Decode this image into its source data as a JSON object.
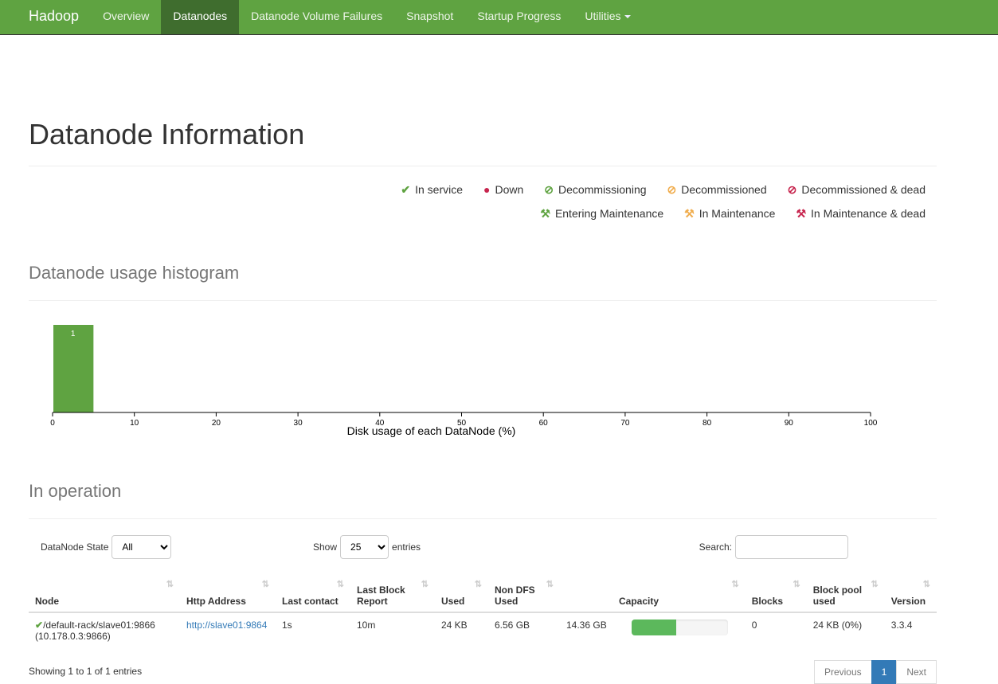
{
  "navbar": {
    "brand": "Hadoop",
    "items": [
      "Overview",
      "Datanodes",
      "Datanode Volume Failures",
      "Snapshot",
      "Startup Progress",
      "Utilities"
    ],
    "active": "Datanodes"
  },
  "page_title": "Datanode Information",
  "legend": [
    {
      "icon": "check-icon",
      "label": "In service",
      "color": "#5fa341"
    },
    {
      "icon": "exclamation-circle-icon",
      "label": "Down",
      "color": "#c7254e"
    },
    {
      "icon": "ban-icon",
      "label": "Decommissioning",
      "color": "#5fa341"
    },
    {
      "icon": "ban-icon",
      "label": "Decommissioned",
      "color": "#f0ad4e"
    },
    {
      "icon": "ban-icon",
      "label": "Decommissioned & dead",
      "color": "#c7254e"
    },
    {
      "icon": "wrench-icon",
      "label": "Entering Maintenance",
      "color": "#5fa341"
    },
    {
      "icon": "wrench-icon",
      "label": "In Maintenance",
      "color": "#f0ad4e"
    },
    {
      "icon": "wrench-icon",
      "label": "In Maintenance & dead",
      "color": "#c7254e"
    }
  ],
  "histogram": {
    "heading": "Datanode usage histogram",
    "chart_data": {
      "type": "bar",
      "xlabel": "Disk usage of each DataNode (%)",
      "xlim": [
        0,
        100
      ],
      "xticks": [
        "0",
        "10",
        "20",
        "30",
        "40",
        "50",
        "60",
        "70",
        "80",
        "90",
        "100"
      ],
      "bins": [
        {
          "x0": 0,
          "x1": 5,
          "count": 1
        }
      ],
      "bar_color": "#5fa341"
    }
  },
  "operation": {
    "heading": "In operation",
    "state_label": "DataNode State",
    "state_value": "All",
    "show_label": "Show",
    "show_value": "25",
    "entries_label": "entries",
    "search_label": "Search:",
    "search_value": "",
    "columns": [
      "Node",
      "Http Address",
      "Last contact",
      "Last Block Report",
      "Used",
      "Non DFS Used",
      "Capacity",
      "Blocks",
      "Block pool used",
      "Version"
    ],
    "rows": [
      {
        "node": "/default-rack/slave01:9866",
        "node_ip": "(10.178.0.3:9866)",
        "http": "http://slave01:9864",
        "last_contact": "1s",
        "last_block_report": "10m",
        "used": "24 KB",
        "non_dfs_used": "6.56 GB",
        "capacity": "14.36 GB",
        "capacity_used_pct": 46,
        "blocks": "0",
        "block_pool_used": "24 KB (0%)",
        "version": "3.3.4"
      }
    ],
    "info": "Showing 1 to 1 of 1 entries",
    "pager": {
      "previous": "Previous",
      "page": "1",
      "next": "Next"
    }
  }
}
